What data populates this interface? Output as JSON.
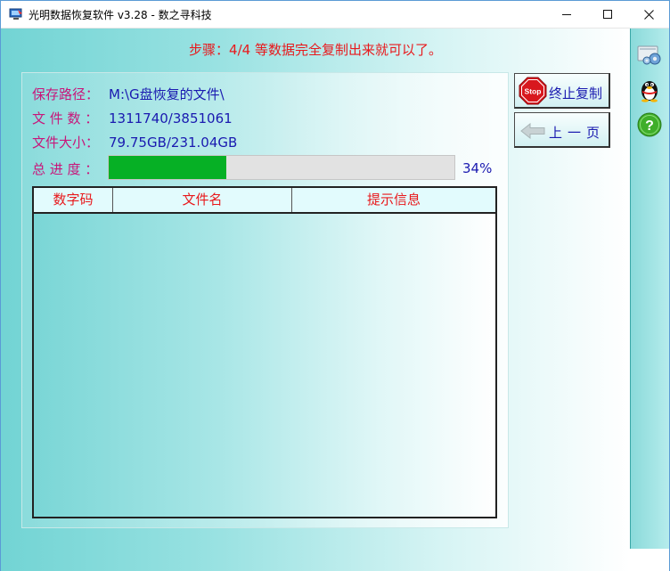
{
  "window": {
    "title": "光明数据恢复软件 v3.28 - 数之寻科技",
    "icons": {
      "app": "app-monitor-icon",
      "minimize": "minimize-icon",
      "maximize": "maximize-icon",
      "close": "close-icon"
    }
  },
  "step": {
    "text": "步骤：4/4 等数据完全复制出来就可以了。",
    "color": "#e8191c"
  },
  "info": {
    "path_label": "保存路径：",
    "path_value": "M:\\G盘恢复的文件\\",
    "files_label": "文 件 数 ：",
    "files_value": "1311740/3851061",
    "size_label": "文件大小：",
    "size_value": "79.75GB/231.04GB",
    "progress_label": "总 进 度 ：",
    "progress_percent": 34,
    "progress_text": "34%",
    "progress_color": "#06b025",
    "label_color": "#c8167a",
    "value_color": "#1a1ab0"
  },
  "table": {
    "columns": [
      "数字码",
      "文件名",
      "提示信息"
    ],
    "rows": []
  },
  "buttons": {
    "stop_label": "终止复制",
    "stop_icon": "stop-sign-icon",
    "prev_label": "上一页",
    "prev_icon": "back-arrow-icon"
  },
  "side_icons": [
    "settings-gears-icon",
    "qq-penguin-icon",
    "help-question-icon"
  ]
}
